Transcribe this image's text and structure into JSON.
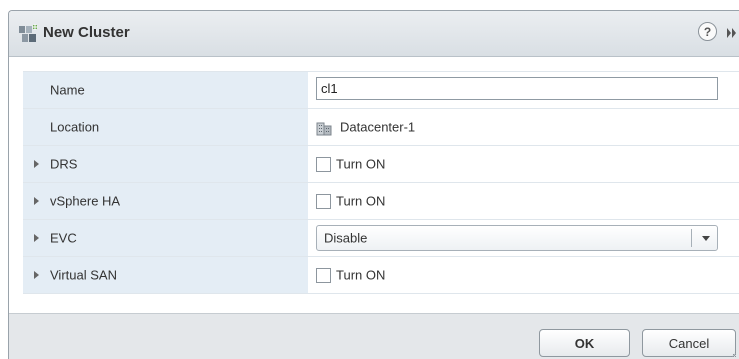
{
  "dialog": {
    "title": "New Cluster",
    "icons": {
      "title": "new-cluster-icon",
      "help": "help-icon",
      "expand": "expand-icon"
    },
    "help_label": "?"
  },
  "form": {
    "rows": [
      {
        "label": "Name",
        "control": "text-input",
        "value": "cl1"
      },
      {
        "label": "Location",
        "control": "static",
        "value": "Datacenter-1",
        "icon": "datacenter-icon"
      },
      {
        "label": "DRS",
        "control": "checkbox",
        "value": "Turn ON",
        "checked": false,
        "expandable": true
      },
      {
        "label": "vSphere HA",
        "control": "checkbox",
        "value": "Turn ON",
        "checked": false,
        "expandable": true
      },
      {
        "label": "EVC",
        "control": "select",
        "value": "Disable",
        "expandable": true
      },
      {
        "label": "Virtual SAN",
        "control": "checkbox",
        "value": "Turn ON",
        "checked": false,
        "expandable": true
      }
    ]
  },
  "footer": {
    "ok_label": "OK",
    "cancel_label": "Cancel"
  },
  "colors": {
    "label_background": "#e4edf5",
    "title_gradient_top": "#ebeef1",
    "title_gradient_bottom": "#d9dfe4",
    "footer_background": "#e4e7ea",
    "row_border": "#dfe6ec"
  }
}
